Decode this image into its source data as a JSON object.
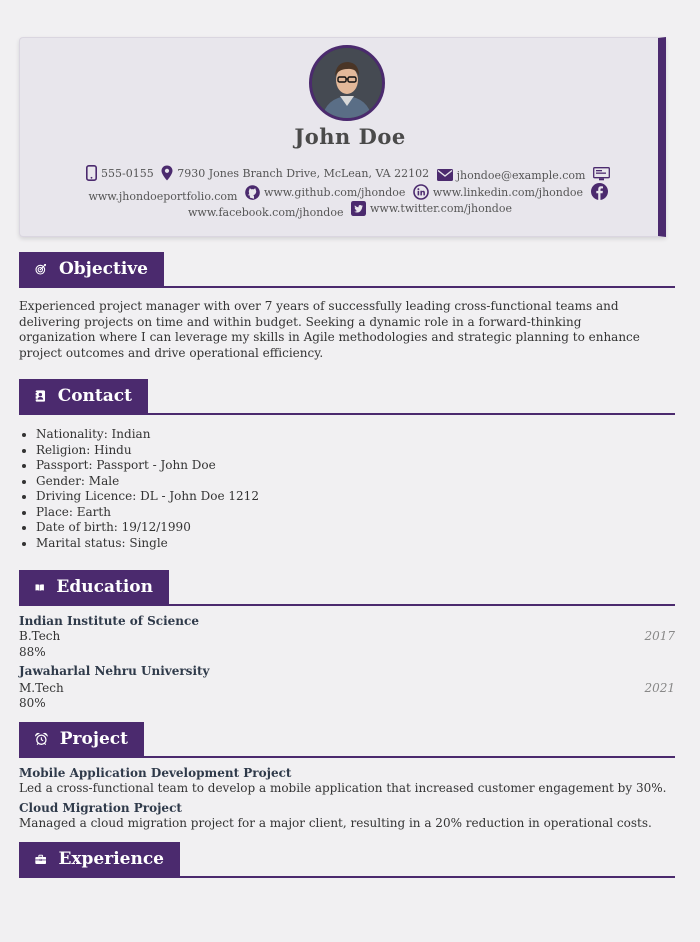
{
  "header": {
    "name": "John Doe",
    "phone": "555-0155",
    "address": "7930 Jones Branch Drive, McLean, VA 22102",
    "email": "jhondoe@example.com",
    "portfolio": "www.jhondoeportfolio.com",
    "github": "www.github.com/jhondoe",
    "linkedin": "www.linkedin.com/jhondoe",
    "facebook": "www.facebook.com/jhondoe",
    "twitter": "www.twitter.com/jhondoe"
  },
  "objective": {
    "title": "Objective",
    "text": "Experienced project manager with over 7 years of successfully leading cross-functional teams and delivering projects on time and within budget. Seeking a dynamic role in a forward-thinking organization where I can leverage my skills in Agile methodologies and strategic planning to enhance project outcomes and drive operational efficiency."
  },
  "contact": {
    "title": "Contact",
    "items": [
      "Nationality: Indian",
      "Religion: Hindu",
      "Passport: Passport - John Doe",
      "Gender: Male",
      "Driving Licence: DL - John Doe 1212",
      "Place: Earth",
      "Date of birth: 19/12/1990",
      "Marital status: Single"
    ]
  },
  "education": {
    "title": "Education",
    "items": [
      {
        "school": "Indian Institute of Science",
        "degree": "B.Tech",
        "score": "88%",
        "year": "2017"
      },
      {
        "school": "Jawaharlal Nehru University",
        "degree": "M.Tech",
        "score": "80%",
        "year": "2021"
      }
    ]
  },
  "project": {
    "title": "Project",
    "items": [
      {
        "name": "Mobile Application Development Project",
        "desc": "Led a cross-functional team to develop a mobile application that increased customer engagement by 30%."
      },
      {
        "name": "Cloud Migration Project",
        "desc": "Managed a cloud migration project for a major client, resulting in a 20% reduction in operational costs."
      }
    ]
  },
  "experience": {
    "title": "Experience"
  },
  "colors": {
    "accent": "#4b2a6e",
    "background": "#f1f0f2",
    "header_card": "#e8e6ec"
  },
  "icons": {
    "phone": "mobile-phone-icon",
    "address": "map-marker-icon",
    "email": "envelope-icon",
    "portfolio": "monitor-icon",
    "github": "github-icon",
    "linkedin": "linkedin-icon",
    "facebook": "facebook-icon",
    "twitter": "twitter-icon",
    "objective": "target-icon",
    "contact": "address-book-icon",
    "education": "open-book-icon",
    "project": "alarm-clock-icon",
    "experience": "briefcase-icon"
  }
}
